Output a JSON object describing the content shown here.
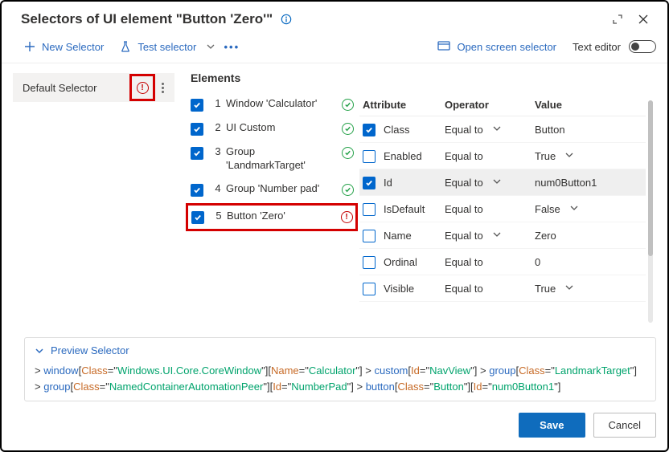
{
  "header": {
    "title": "Selectors of UI element \"Button 'Zero'\""
  },
  "toolbar": {
    "new_selector": "New Selector",
    "test_selector": "Test selector",
    "open_screen_selector": "Open screen selector",
    "text_editor": "Text editor"
  },
  "sidebar": {
    "default_selector": "Default Selector"
  },
  "elements": {
    "title": "Elements",
    "items": [
      {
        "idx": "1",
        "label": "Window 'Calculator'",
        "checked": true,
        "status": "ok"
      },
      {
        "idx": "2",
        "label": "UI Custom",
        "checked": true,
        "status": "ok"
      },
      {
        "idx": "3",
        "label": "Group 'LandmarkTarget'",
        "checked": true,
        "status": "ok"
      },
      {
        "idx": "4",
        "label": "Group 'Number pad'",
        "checked": true,
        "status": "ok"
      },
      {
        "idx": "5",
        "label": "Button 'Zero'",
        "checked": true,
        "status": "err"
      }
    ]
  },
  "attrs": {
    "hdr_attribute": "Attribute",
    "hdr_operator": "Operator",
    "hdr_value": "Value",
    "rows": [
      {
        "checked": true,
        "attr": "Class",
        "op": "Equal to",
        "op_caret": true,
        "val": "Button",
        "val_caret": false
      },
      {
        "checked": false,
        "attr": "Enabled",
        "op": "Equal to",
        "op_caret": false,
        "val": "True",
        "val_caret": true
      },
      {
        "checked": true,
        "attr": "Id",
        "op": "Equal to",
        "op_caret": true,
        "val": "num0Button1",
        "val_caret": false,
        "sel": true
      },
      {
        "checked": false,
        "attr": "IsDefault",
        "op": "Equal to",
        "op_caret": false,
        "val": "False",
        "val_caret": true
      },
      {
        "checked": false,
        "attr": "Name",
        "op": "Equal to",
        "op_caret": true,
        "val": "Zero",
        "val_caret": false
      },
      {
        "checked": false,
        "attr": "Ordinal",
        "op": "Equal to",
        "op_caret": false,
        "val": "0",
        "val_caret": false
      },
      {
        "checked": false,
        "attr": "Visible",
        "op": "Equal to",
        "op_caret": false,
        "val": "True",
        "val_caret": true
      }
    ]
  },
  "preview": {
    "label": "Preview Selector",
    "segments": [
      {
        "op": ">",
        "tag": "window",
        "pairs": [
          {
            "a": "Class",
            "v": "Windows.UI.Core.CoreWindow"
          },
          {
            "a": "Name",
            "v": "Calculator"
          }
        ]
      },
      {
        "op": ">",
        "tag": "custom",
        "pairs": [
          {
            "a": "Id",
            "v": "NavView"
          }
        ]
      },
      {
        "op": ">",
        "tag": "group",
        "pairs": [
          {
            "a": "Class",
            "v": "LandmarkTarget"
          }
        ]
      },
      {
        "op": ">",
        "tag": "group",
        "pairs": [
          {
            "a": "Class",
            "v": "NamedContainerAutomationPeer"
          },
          {
            "a": "Id",
            "v": "NumberPad"
          }
        ]
      },
      {
        "op": ">",
        "tag": "button",
        "pairs": [
          {
            "a": "Class",
            "v": "Button"
          },
          {
            "a": "Id",
            "v": "num0Button1"
          }
        ]
      }
    ]
  },
  "footer": {
    "save": "Save",
    "cancel": "Cancel"
  }
}
